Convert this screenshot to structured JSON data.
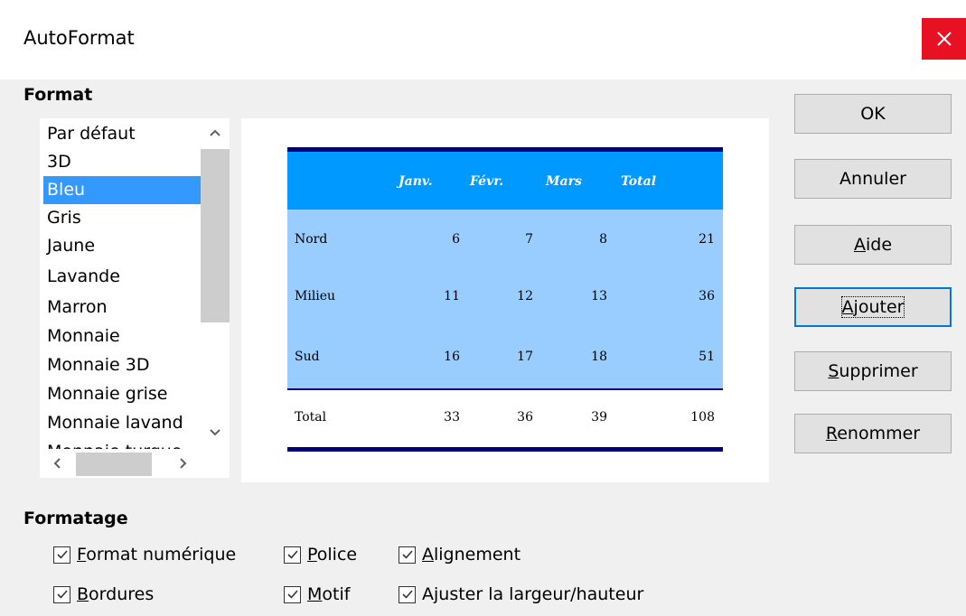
{
  "window": {
    "title": "AutoFormat"
  },
  "format_section": {
    "label": "Format",
    "items": [
      "Par défaut",
      "3D",
      "Bleu",
      "Gris",
      "Jaune",
      "Lavande",
      "Marron",
      "Monnaie",
      "Monnaie 3D",
      "Monnaie grise",
      "Monnaie lavand",
      "Monnaie turquo"
    ],
    "selected": "Bleu"
  },
  "preview": {
    "header": [
      "",
      "Janv.",
      "Févr.",
      "Mars",
      "Total"
    ],
    "rows": [
      [
        "Nord",
        "6",
        "7",
        "8",
        "21"
      ],
      [
        "Milieu",
        "11",
        "12",
        "13",
        "36"
      ],
      [
        "Sud",
        "16",
        "17",
        "18",
        "51"
      ]
    ],
    "total_row": [
      "Total",
      "33",
      "36",
      "39",
      "108"
    ],
    "colors": {
      "header": "#0099ff",
      "body": "#99ccff",
      "border": "#000080"
    }
  },
  "buttons": {
    "ok": "OK",
    "cancel": "Annuler",
    "help_ul": "A",
    "help_rest": "ide",
    "add_ul": "A",
    "add_rest": "jouter",
    "delete_ul": "S",
    "delete_rest": "upprimer",
    "rename_ul": "R",
    "rename_rest": "enommer"
  },
  "formatting_section": {
    "label": "Formatage",
    "number_format_ul": "F",
    "number_format_rest": "ormat numérique",
    "font_ul": "P",
    "font_rest": "olice",
    "alignment_ul": "A",
    "alignment_rest": "lignement",
    "borders_ul": "B",
    "borders_rest": "ordures",
    "pattern_ul": "M",
    "pattern_rest": "otif",
    "autofit": "Ajuster la largeur/hauteur"
  },
  "icons": [
    "close-icon",
    "chevron-up-icon",
    "chevron-down-icon",
    "chevron-left-icon",
    "chevron-right-icon",
    "checkmark-icon"
  ],
  "accent_color": "#0078d7",
  "close_color": "#e81123"
}
